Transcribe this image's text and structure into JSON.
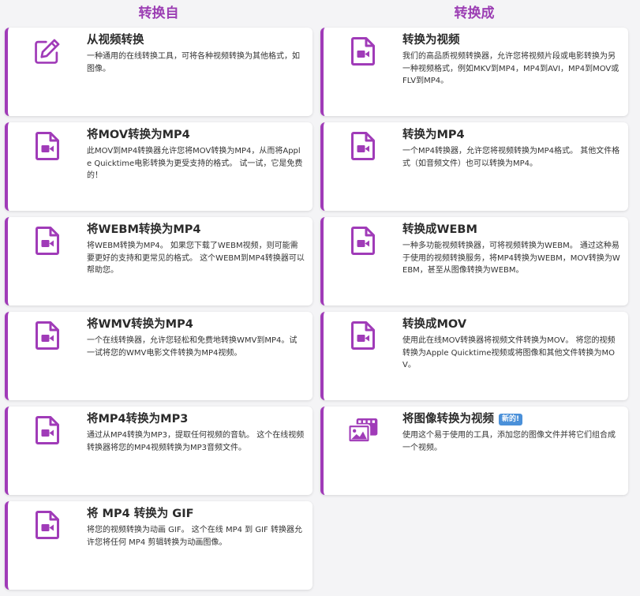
{
  "columns": {
    "left_title": "转换自",
    "right_title": "转换成"
  },
  "left_cards": [
    {
      "icon": "edit-icon",
      "title": "从视频转换",
      "desc": "一种通用的在线转换工具，可将各种视频转换为其他格式，如图像。"
    },
    {
      "icon": "video-file-icon",
      "title": "将MOV转换为MP4",
      "desc": "此MOV到MP4转换器允许您将MOV转换为MP4，从而将Apple Quicktime电影转换为更受支持的格式。 试一试，它是免费的！"
    },
    {
      "icon": "video-file-icon",
      "title": "将WEBM转换为MP4",
      "desc": "将WEBM转换为MP4。 如果您下载了WEBM视频，则可能需要更好的支持和更常见的格式。 这个WEBM到MP4转换器可以帮助您。"
    },
    {
      "icon": "video-file-icon",
      "title": "将WMV转换为MP4",
      "desc": "一个在线转换器，允许您轻松和免费地转换WMV到MP4。试一试将您的WMV电影文件转换为MP4视频。"
    },
    {
      "icon": "video-file-icon",
      "title": "将MP4转换为MP3",
      "desc": "通过从MP4转换为MP3，提取任何视频的音轨。 这个在线视频转换器将您的MP4视频转换为MP3音频文件。"
    },
    {
      "icon": "video-file-icon",
      "title": "将 MP4 转换为 GIF",
      "desc": "将您的视频转换为动画 GIF。 这个在线 MP4 到 GIF 转换器允许您将任何 MP4 剪辑转换为动画图像。"
    }
  ],
  "right_cards": [
    {
      "icon": "video-file-icon",
      "title": "转换为视频",
      "desc": "我们的高品质视频转换器，允许您将视频片段或电影转换为另一种视频格式，例如MKV到MP4，MP4到AVI，MP4到MOV或FLV到MP4。"
    },
    {
      "icon": "video-file-icon",
      "title": "转换为MP4",
      "desc": "一个MP4转换器，允许您将视频转换为MP4格式。 其他文件格式（如音频文件）也可以转换为MP4。"
    },
    {
      "icon": "video-file-icon",
      "title": "转换成WEBM",
      "desc": "一种多功能视频转换器，可将视频转换为WEBM。 通过这种易于使用的视频转换服务，将MP4转换为WEBM，MOV转换为WEBM，甚至从图像转换为WEBM。"
    },
    {
      "icon": "video-file-icon",
      "title": "转换成MOV",
      "desc": "使用此在线MOV转换器将视频文件转换为MOV。 将您的视频转换为Apple Quicktime视频或将图像和其他文件转换为MOV。"
    },
    {
      "icon": "images-to-video-icon",
      "title": "将图像转换为视频",
      "badge": "新的!",
      "desc": "使用这个易于使用的工具，添加您的图像文件并将它们组合成一个视频。"
    }
  ],
  "colors": {
    "accent": "#a03bb8",
    "title": "#9b3db3",
    "badge": "#4a90d9"
  }
}
